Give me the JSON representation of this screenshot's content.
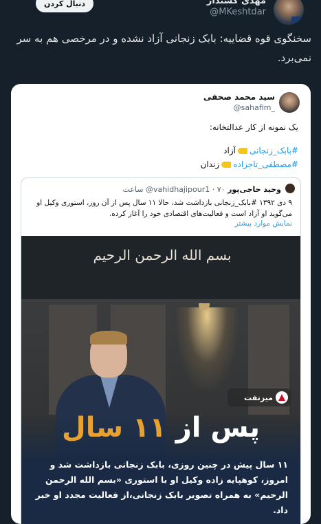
{
  "header": {
    "display_name": "مهدی کشتدار",
    "handle": "@MKeshtdar",
    "follow_label": "دنبال کردن"
  },
  "tweet": {
    "text": "سخنگوی قوه قضاییه: بابک زنجانی آزاد نشده و در مرخصی هم به سر نمی‌برد."
  },
  "embedded": {
    "author_name": "سید محمد صحفی",
    "author_handle": "@sahafim_",
    "line1": "یک نمونه از کار عدالتخانه:",
    "hash1": "#بابک_زنجانی",
    "hash1_suffix": "آزاد",
    "hash2": "#مصطفی_تاجزاده",
    "hash2_suffix": "زندان"
  },
  "quoted": {
    "author_name": "وحید حاجی‌پور",
    "author_handle": "@vahidhajipour1",
    "time": "۷۰ ساعت",
    "text": "۹ دی ۱۳۹۲ #بابک_زنجانی بازداشت شد، حالا ۱۱ سال پس از آن روز، استوری وکیل او می‌گوید او آزاد است و فعالیت‌های اقتصادی خود را آغاز کرده.",
    "show_more": "نمایش موارد بیشتر"
  },
  "image": {
    "calligraphy": "بسم الله الرحمن الرحیم",
    "logo_text": "میزنفت",
    "headline_prefix": "پس از",
    "headline_number": "۱۱",
    "headline_suffix": "سال",
    "caption": "۱۱ سال پیش در چنین روزی، بابک زنجانی بازداشت شد و امروز، کوهپایه زاده وکیل او با استوری «بسم الله الرحمن الرحیم» به همراه تصویر بابک زنجانی،از فعالیت مجدد او خبر داد."
  },
  "colors": {
    "background": "#15202b",
    "link": "#1d9bf0",
    "accent_number": "#e8a030"
  }
}
